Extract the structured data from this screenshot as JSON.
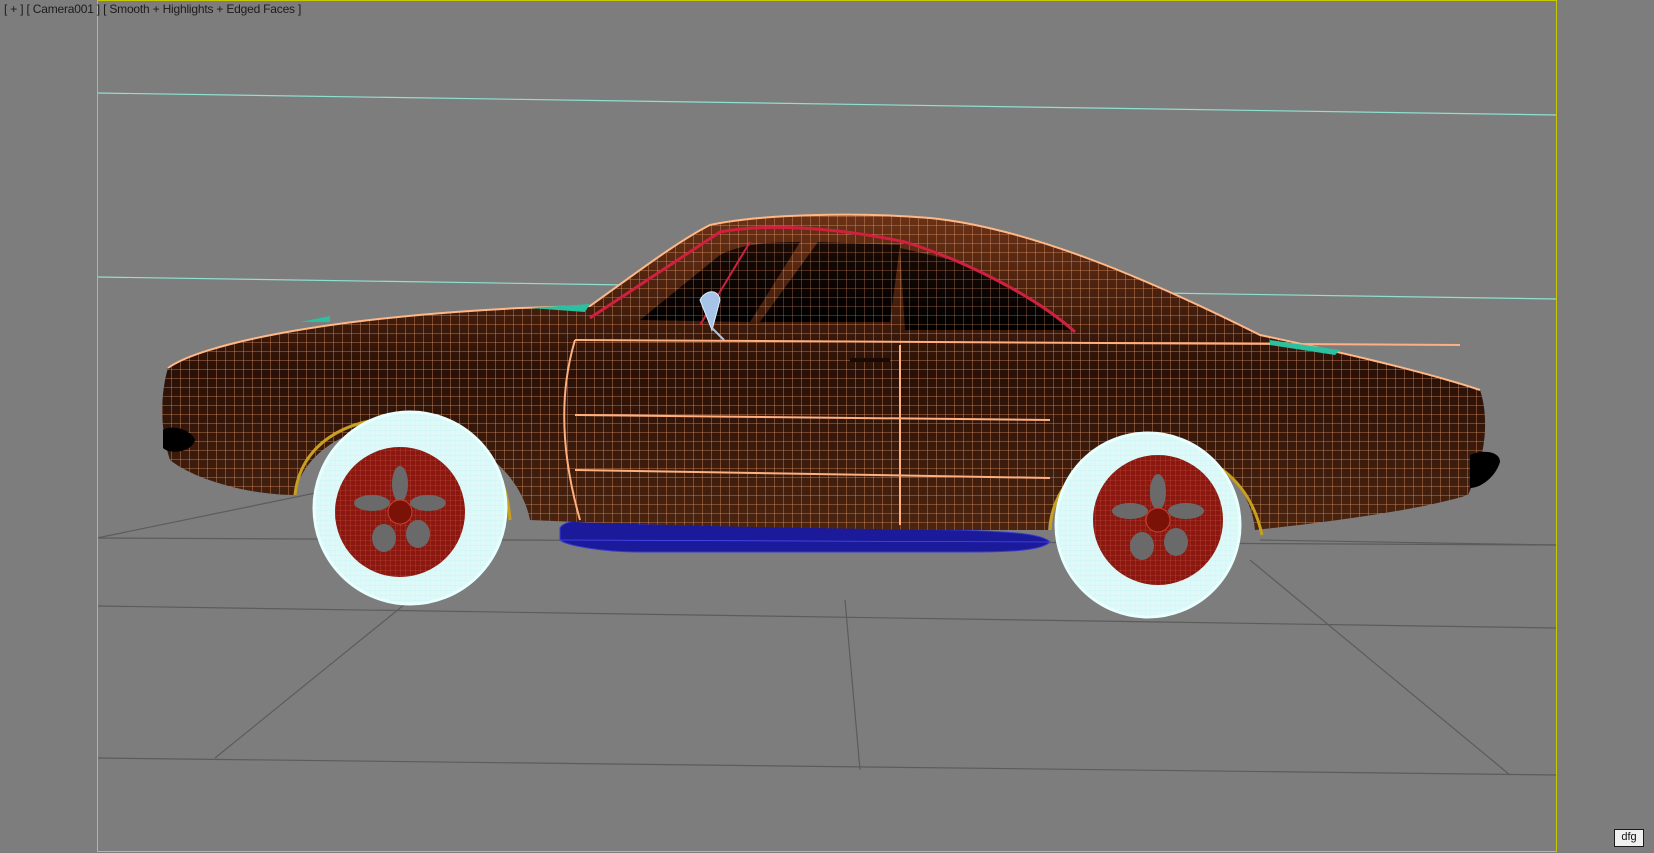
{
  "viewport": {
    "menu_label": "[ + ]",
    "camera_label": "[ Camera001 ]",
    "shading_label": "[ Smooth + Highlights + Edged Faces ]",
    "badge_text": "dfg"
  },
  "colors": {
    "background": "#7d7d7d",
    "safe_frame": "#c8c800",
    "body_wire": "#f0a070",
    "body_dark": "#2a1206",
    "tire_wire": "#b8f2f2",
    "rim": "#9a1a14",
    "exhaust": "#1a1a9a",
    "horizon_lines": "#8fe0d0",
    "trim_accent": "#2ac0a0"
  }
}
